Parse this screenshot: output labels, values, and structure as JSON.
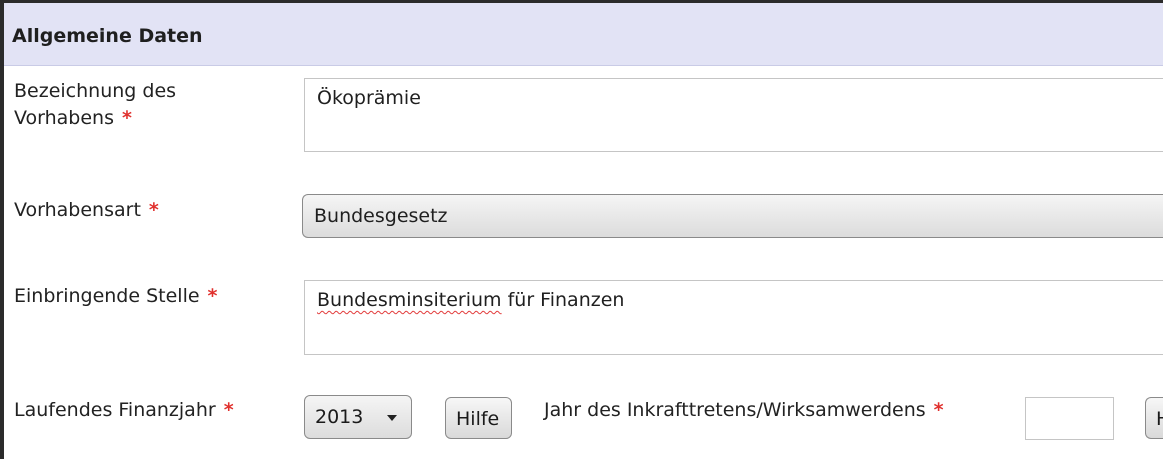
{
  "section": {
    "title": "Allgemeine Daten"
  },
  "required_marker": "*",
  "fields": {
    "bezeichnung": {
      "label_line1": "Bezeichnung des",
      "label_line2": "Vorhabens",
      "value": "Ökoprämie"
    },
    "vorhabensart": {
      "label": "Vorhabensart",
      "value": "Bundesgesetz"
    },
    "einbringende_stelle": {
      "label": "Einbringende Stelle",
      "value_misspelled": "Bundesminsiterium",
      "value_rest": " für Finanzen"
    },
    "finanzjahr": {
      "label": "Laufendes Finanzjahr",
      "value": "2013",
      "help_button": "Hilfe"
    },
    "inkrafttreten": {
      "label": "Jahr des Inkrafttretens/Wirksamwerdens",
      "value": "",
      "help_button_partial": "H"
    }
  },
  "colors": {
    "header_bg": "#e2e3f5",
    "required": "#e0302d"
  }
}
